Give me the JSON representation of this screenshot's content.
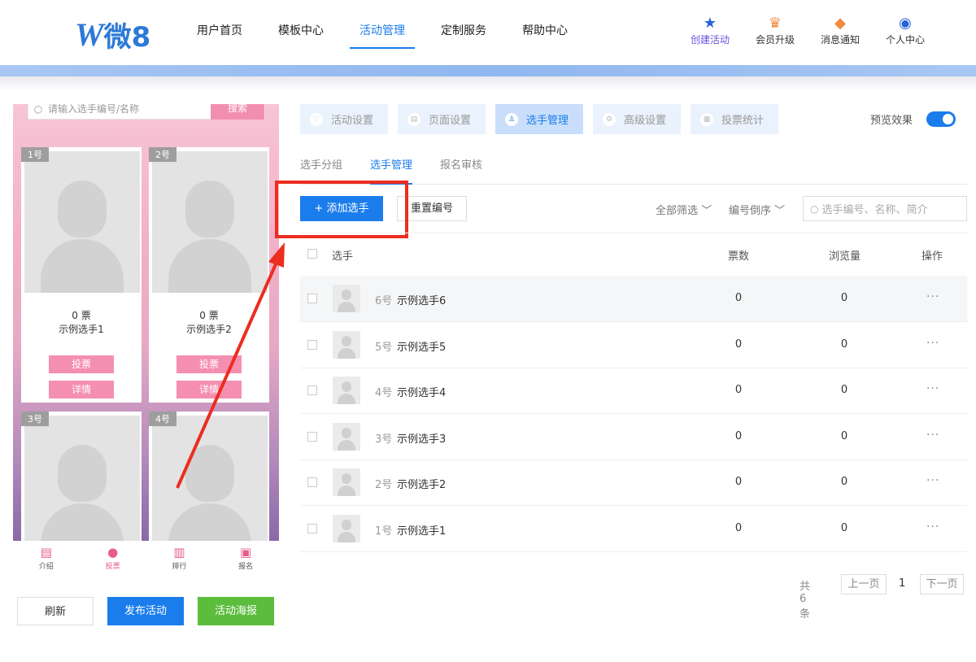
{
  "header": {
    "logo_text": "微8",
    "nav": [
      "用户首页",
      "模板中心",
      "活动管理",
      "定制服务",
      "帮助中心"
    ],
    "tools": [
      "创建活动",
      "会员升级",
      "消息通知",
      "个人中心"
    ]
  },
  "phone": {
    "search_placeholder": "请输入选手编号/名称",
    "search_button": "搜索",
    "cards": [
      {
        "num": "1号",
        "votes": "0 票",
        "name": "示例选手1",
        "vote_btn": "投票",
        "detail_btn": "详情"
      },
      {
        "num": "2号",
        "votes": "0 票",
        "name": "示例选手2",
        "vote_btn": "投票",
        "detail_btn": "详情"
      },
      {
        "num": "3号"
      },
      {
        "num": "4号"
      }
    ],
    "bottom_nav": [
      "介绍",
      "投票",
      "排行",
      "报名"
    ]
  },
  "actions": {
    "refresh": "刷新",
    "publish": "发布活动",
    "poster": "活动海报"
  },
  "settings_tabs": [
    "活动设置",
    "页面设置",
    "选手管理",
    "高级设置",
    "投票统计"
  ],
  "preview_label": "预览效果",
  "sub_tabs": [
    "选手分组",
    "选手管理",
    "报名审核"
  ],
  "toolbar": {
    "add": "+ 添加选手",
    "reset": "重置编号",
    "filter_all": "全部筛选",
    "sort": "编号倒序",
    "search_placeholder": "选手编号、名称、简介"
  },
  "table": {
    "headers": {
      "player": "选手",
      "votes": "票数",
      "views": "浏览量",
      "ops": "操作"
    },
    "rows": [
      {
        "num": "6号",
        "name": "示例选手6",
        "votes": "0",
        "views": "0"
      },
      {
        "num": "5号",
        "name": "示例选手5",
        "votes": "0",
        "views": "0"
      },
      {
        "num": "4号",
        "name": "示例选手4",
        "votes": "0",
        "views": "0"
      },
      {
        "num": "3号",
        "name": "示例选手3",
        "votes": "0",
        "views": "0"
      },
      {
        "num": "2号",
        "name": "示例选手2",
        "votes": "0",
        "views": "0"
      },
      {
        "num": "1号",
        "name": "示例选手1",
        "votes": "0",
        "views": "0"
      }
    ]
  },
  "pagination": {
    "total": "共 6 条",
    "prev": "上一页",
    "page": "1",
    "next": "下一页"
  },
  "colors": {
    "accent": "#1b7dec",
    "annotation": "#ec2d20",
    "vote_pink": "#f48fb1",
    "poster_green": "#5bbd3c"
  }
}
